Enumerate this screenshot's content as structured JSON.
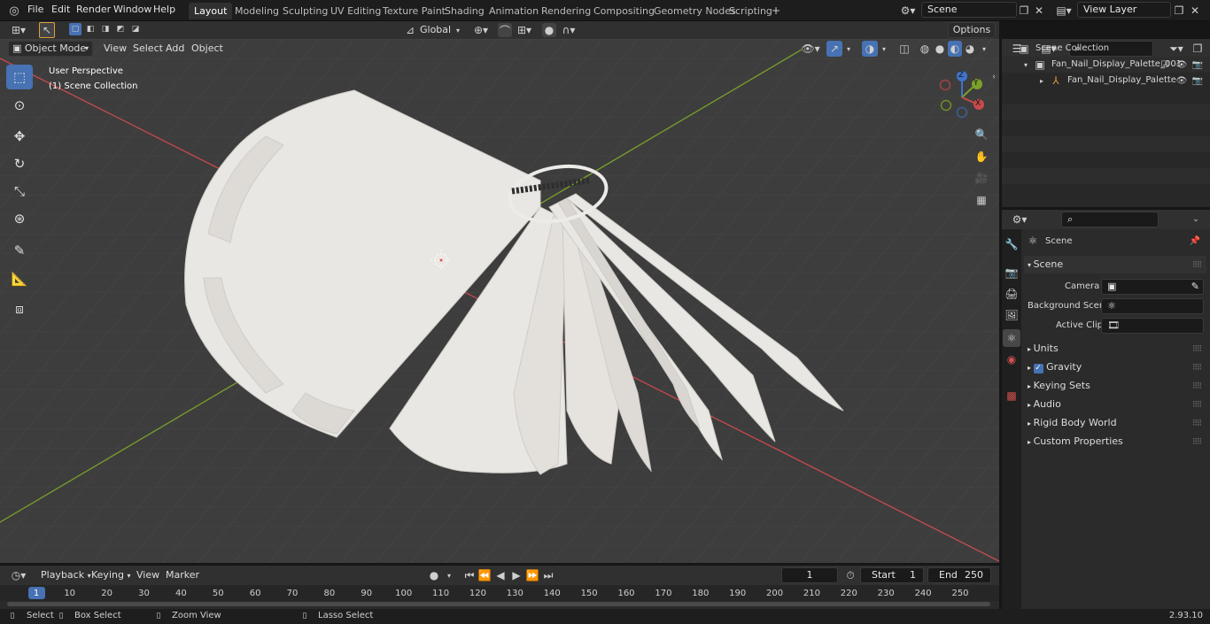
{
  "menus": [
    "File",
    "Edit",
    "Render",
    "Window",
    "Help"
  ],
  "workspaces": [
    "Layout",
    "Modeling",
    "Sculpting",
    "UV Editing",
    "Texture Paint",
    "Shading",
    "Animation",
    "Rendering",
    "Compositing",
    "Geometry Nodes",
    "Scripting"
  ],
  "active_workspace": "Layout",
  "scene_field": "Scene",
  "view_layer_field": "View Layer",
  "viewport": {
    "mode": "Object Mode",
    "menu_view": "View",
    "menu_select": "Select",
    "menu_add": "Add",
    "menu_object": "Object",
    "transform_orientation": "Global",
    "options_label": "Options",
    "perspective_label": "User Perspective",
    "collection_label": "(1) Scene Collection",
    "gizmo": {
      "x": "X",
      "y": "Y",
      "z": "Z"
    }
  },
  "outliner": {
    "root": "Scene Collection",
    "item1": "Fan_Nail_Display_Palette_001",
    "item2": "Fan_Nail_Display_Palette"
  },
  "properties": {
    "context": "Scene",
    "section": "Scene",
    "camera_label": "Camera",
    "background_label": "Background Scene",
    "active_clip_label": "Active Clip",
    "panels": [
      "Units",
      "Gravity",
      "Keying Sets",
      "Audio",
      "Rigid Body World",
      "Custom Properties"
    ]
  },
  "timeline": {
    "playback": "Playback",
    "keying": "Keying",
    "view": "View",
    "marker": "Marker",
    "current_frame": "1",
    "start_label": "Start",
    "start_value": "1",
    "end_label": "End",
    "end_value": "250",
    "ticks": [
      "1",
      "10",
      "20",
      "30",
      "40",
      "50",
      "60",
      "70",
      "80",
      "90",
      "100",
      "110",
      "120",
      "130",
      "140",
      "150",
      "160",
      "170",
      "180",
      "190",
      "200",
      "210",
      "220",
      "230",
      "240",
      "250"
    ]
  },
  "status": {
    "select": "Select",
    "box_select": "Box Select",
    "zoom_view": "Zoom View",
    "lasso_select": "Lasso Select",
    "version": "2.93.10"
  },
  "colors": {
    "accent": "#4772b3",
    "x_axis": "#c94a4a",
    "y_axis": "#7aa12a",
    "z_axis": "#3f74c9"
  }
}
